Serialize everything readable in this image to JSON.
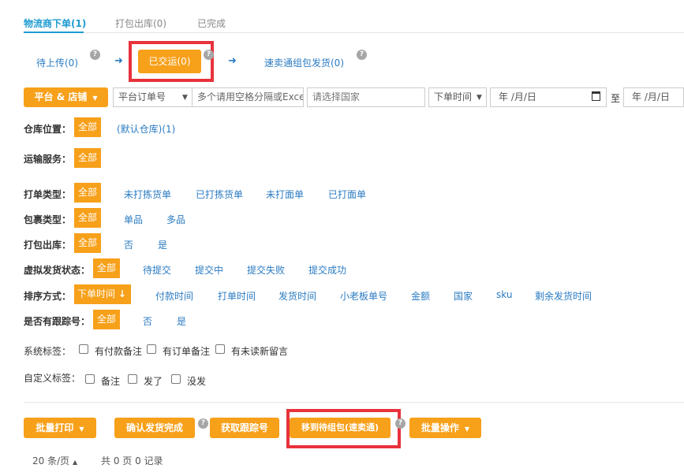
{
  "tabs": [
    {
      "label": "物流商下单(1)",
      "active": true
    },
    {
      "label": "打包出库(0)",
      "active": false
    },
    {
      "label": "已完成",
      "active": false
    }
  ],
  "flow": {
    "step1": "待上传(0)",
    "step2": "已交运(0)",
    "step3": "速卖通组包发货(0)",
    "help_glyph": "?",
    "arrow_glyph": "➜"
  },
  "filters": {
    "platform_button": "平台 & 店铺",
    "order_type_select": "平台订单号",
    "order_input_placeholder": "多个请用空格分隔或Excel复制粘贴",
    "country_placeholder": "请选择国家",
    "time_select": "下单时间",
    "date_start": "年 /月/日",
    "to_label": "至",
    "date_end": "年 /月/日"
  },
  "rows": {
    "warehouse": {
      "label": "仓库位置：",
      "all": "全部",
      "options": [
        "(默认仓库)(1)"
      ]
    },
    "shipping": {
      "label": "运输服务：",
      "all": "全部",
      "options": []
    },
    "print_type": {
      "label": "打单类型：",
      "all": "全部",
      "options": [
        "未打拣货单",
        "已打拣货单",
        "未打面单",
        "已打面单"
      ]
    },
    "package_type": {
      "label": "包裹类型：",
      "all": "全部",
      "options": [
        "单品",
        "多品"
      ]
    },
    "pack_out": {
      "label": "打包出库：",
      "all": "全部",
      "options": [
        "否",
        "是"
      ]
    },
    "virtual_status": {
      "label": "虚拟发货状态：",
      "all": "全部",
      "options": [
        "待提交",
        "提交中",
        "提交失败",
        "提交成功"
      ]
    },
    "sort": {
      "label": "排序方式：",
      "active": "下单时间",
      "sort_icon": "↓",
      "options": [
        "付款时间",
        "打单时间",
        "发货时间",
        "小老板单号",
        "金额",
        "国家",
        "sku",
        "剩余发货时间"
      ]
    },
    "tracking": {
      "label": "是否有跟踪号：",
      "all": "全部",
      "options": [
        "否",
        "是"
      ]
    },
    "sys_tags": {
      "label": "系统标签：",
      "options": [
        "有付款备注",
        "有订单备注",
        "有未读新留言"
      ]
    },
    "custom_tags": {
      "label": "自定义标签：",
      "options": [
        "备注",
        "发了",
        "没发"
      ]
    }
  },
  "actions": {
    "batch_print": "批量打印",
    "confirm_ship": "确认发货完成",
    "get_tracking": "获取跟踪号",
    "move_to_group": "移到待组包(速卖通)",
    "batch_ops": "批量操作"
  },
  "pager": {
    "per_page": "20 条/页",
    "caret": "▲",
    "summary": "共 0 页 0 记录"
  },
  "colors": {
    "accent": "#f7a01a",
    "link": "#2b7bc2",
    "tab_active": "#1e9bd1",
    "highlight": "#e8323c"
  }
}
